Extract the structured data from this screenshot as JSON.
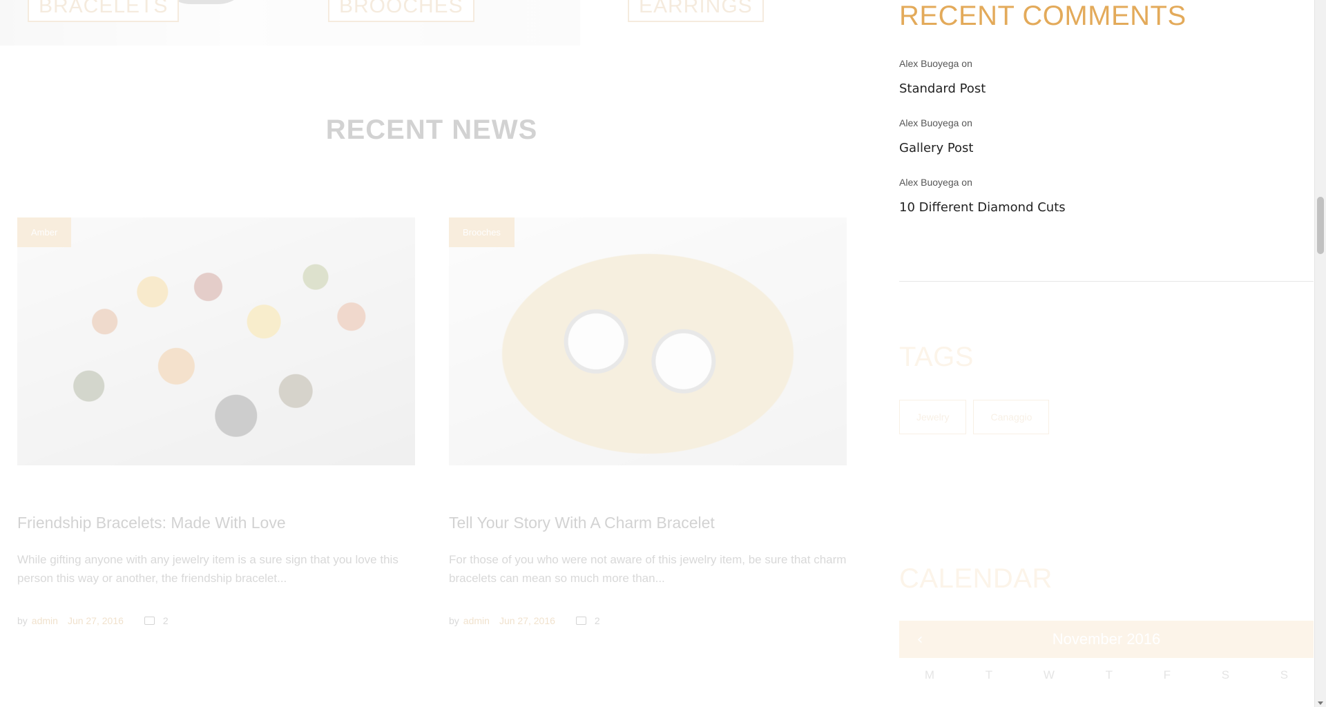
{
  "categories": [
    {
      "label": "BRACELETS"
    },
    {
      "label": "BROOCHES"
    },
    {
      "label": "EARRINGS"
    }
  ],
  "recent_news": {
    "heading": "RECENT NEWS",
    "posts": [
      {
        "badge": "Amber",
        "title": "Friendship Bracelets: Made With Love",
        "excerpt": "While gifting anyone with any jewelry item is a sure sign that you love this person this way or another, the friendship bracelet...",
        "by": "by",
        "author": "admin",
        "date": "Jun 27, 2016",
        "comments": "2"
      },
      {
        "badge": "Brooches",
        "title": "Tell Your Story With A Charm Bracelet",
        "excerpt": "For those of you who were not aware of this jewelry item, be sure that charm bracelets can mean so much more than...",
        "by": "by",
        "author": "admin",
        "date": "Jun 27, 2016",
        "comments": "2"
      }
    ]
  },
  "sidebar": {
    "recent_comments": {
      "title": "RECENT COMMENTS",
      "items": [
        {
          "author": "Alex Buoyega on",
          "post": "Standard Post"
        },
        {
          "author": "Alex Buoyega on",
          "post": "Gallery Post"
        },
        {
          "author": "Alex Buoyega on",
          "post": "10 Different Diamond Cuts"
        }
      ]
    },
    "tags": {
      "title": "TAGS",
      "items": [
        "Jewelry",
        "Canaggio"
      ]
    },
    "calendar": {
      "title": "CALENDAR",
      "prev": "‹",
      "month": "November 2016",
      "weekdays": [
        "M",
        "T",
        "W",
        "T",
        "F",
        "S",
        "S"
      ]
    }
  },
  "colors": {
    "accent": "#e3aa5a",
    "text": "#222222",
    "muted": "#555555"
  }
}
